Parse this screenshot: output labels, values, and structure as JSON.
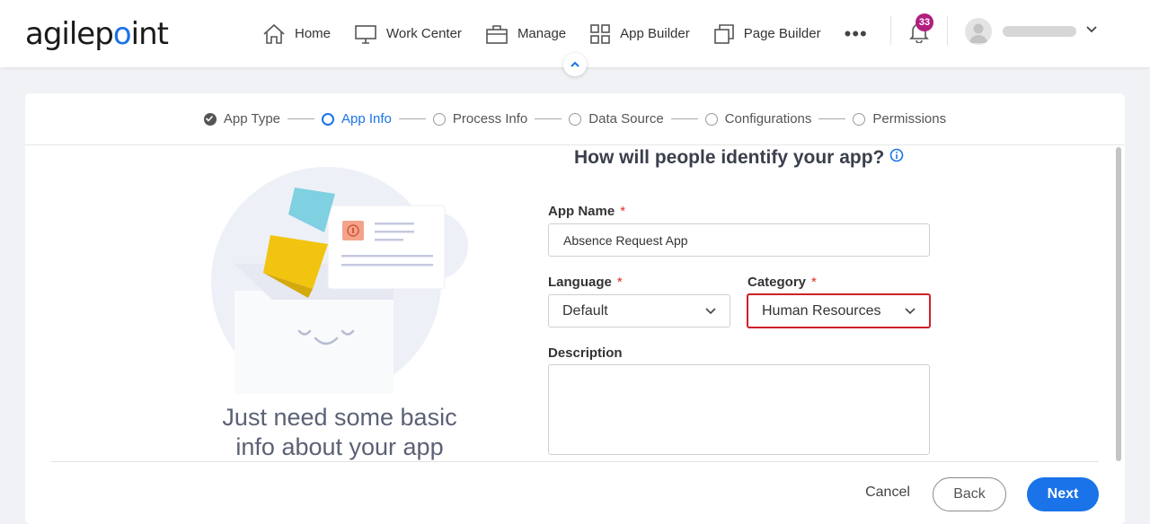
{
  "brand": {
    "logo_text_a": "agilep",
    "logo_text_b": "int",
    "accent": "#1a73e8"
  },
  "nav": {
    "items": [
      {
        "label": "Home",
        "icon": "home-icon"
      },
      {
        "label": "Work Center",
        "icon": "monitor-icon"
      },
      {
        "label": "Manage",
        "icon": "briefcase-icon"
      },
      {
        "label": "App Builder",
        "icon": "grid-icon"
      },
      {
        "label": "Page Builder",
        "icon": "pages-icon"
      }
    ],
    "more": "•••",
    "notifications_count": "33"
  },
  "stepper": {
    "steps": [
      {
        "label": "App Type",
        "state": "done"
      },
      {
        "label": "App Info",
        "state": "active"
      },
      {
        "label": "Process Info",
        "state": "pending"
      },
      {
        "label": "Data Source",
        "state": "pending"
      },
      {
        "label": "Configurations",
        "state": "pending"
      },
      {
        "label": "Permissions",
        "state": "pending"
      }
    ]
  },
  "illustration": {
    "tagline_line1": "Just need some basic",
    "tagline_line2": "info about your app"
  },
  "form": {
    "title": "How will people identify your app?",
    "app_name": {
      "label": "App Name",
      "required": "*",
      "value": "Absence Request App"
    },
    "language": {
      "label": "Language",
      "required": "*",
      "value": "Default"
    },
    "category": {
      "label": "Category",
      "required": "*",
      "value": "Human Resources"
    },
    "description": {
      "label": "Description",
      "value": ""
    }
  },
  "footer": {
    "cancel": "Cancel",
    "back": "Back",
    "next": "Next"
  }
}
